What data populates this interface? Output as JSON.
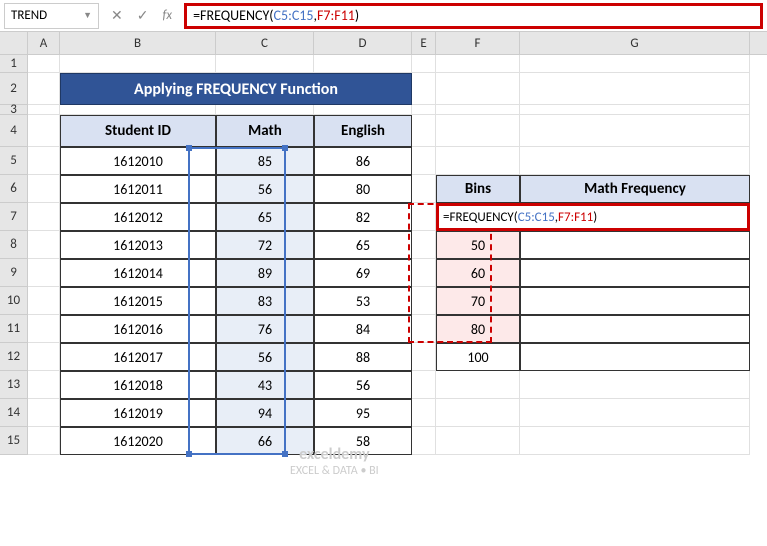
{
  "nameBox": "TREND",
  "formula": "=FREQUENCY(C5:C15,F7:F11)",
  "formulaParts": {
    "pre": "=FREQUENCY(",
    "arg1": "C5:C15",
    "sep": ",",
    "arg2": "F7:F11",
    "post": ")"
  },
  "columns": [
    "A",
    "B",
    "C",
    "D",
    "E",
    "F",
    "G"
  ],
  "title": "Applying FREQUENCY Function",
  "headers": {
    "b": "Student ID",
    "c": "Math",
    "d": "English"
  },
  "binsHeaders": {
    "f": "Bins",
    "g": "Math Frequency"
  },
  "rows": [
    {
      "id": "1612010",
      "math": "85",
      "eng": "86"
    },
    {
      "id": "1612011",
      "math": "56",
      "eng": "80"
    },
    {
      "id": "1612012",
      "math": "65",
      "eng": "82"
    },
    {
      "id": "1612013",
      "math": "72",
      "eng": "65"
    },
    {
      "id": "1612014",
      "math": "89",
      "eng": "69"
    },
    {
      "id": "1612015",
      "math": "83",
      "eng": "53"
    },
    {
      "id": "1612016",
      "math": "76",
      "eng": "84"
    },
    {
      "id": "1612017",
      "math": "56",
      "eng": "88"
    },
    {
      "id": "1612018",
      "math": "43",
      "eng": "56"
    },
    {
      "id": "1612019",
      "math": "94",
      "eng": "95"
    },
    {
      "id": "1612020",
      "math": "66",
      "eng": "58"
    }
  ],
  "bins": [
    "50",
    "60",
    "70",
    "80",
    "100"
  ],
  "watermark": {
    "brand": "exceldemy",
    "tagline": "EXCEL & DATA • BI"
  }
}
